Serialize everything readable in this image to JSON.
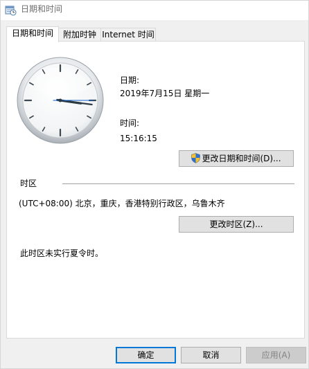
{
  "window": {
    "title": "日期和时间"
  },
  "tabs": [
    {
      "label": "日期和时间",
      "active": true
    },
    {
      "label": "附加时钟",
      "active": false
    },
    {
      "label": "Internet 时间",
      "active": false
    }
  ],
  "clock": {
    "hour": 15,
    "minute": 16,
    "second": 15
  },
  "date": {
    "label": "日期:",
    "value": "2019年7月15日 星期一"
  },
  "time": {
    "label": "时间:",
    "value": "15:16:15"
  },
  "buttons": {
    "change_datetime": "更改日期和时间(D)...",
    "change_timezone": "更改时区(Z)...",
    "ok": "确定",
    "cancel": "取消",
    "apply": "应用(A)"
  },
  "timezone": {
    "group_label": "时区",
    "value": "(UTC+08:00) 北京，重庆，香港特别行政区，乌鲁木齐",
    "dst_note": "此时区未实行夏令时。"
  },
  "colors": {
    "accent": "#0078d7",
    "second_hand": "#0a5ec8",
    "hands": "#2c3a44"
  },
  "icons": {
    "title": "clock-settings-icon",
    "shield": "uac-shield-icon"
  }
}
